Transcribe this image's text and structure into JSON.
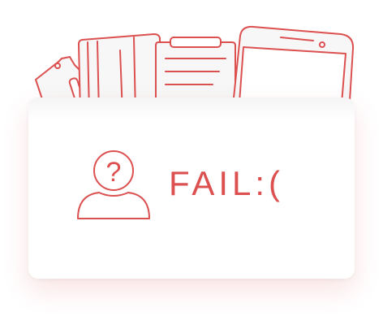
{
  "message": {
    "text": "FAIL:("
  },
  "icons": {
    "user": "unknown-user-icon",
    "question_mark": "?",
    "documents": [
      "ticket-icon",
      "card-icon",
      "clipboard-icon",
      "phone-icon"
    ]
  },
  "colors": {
    "accent": "#dc5050",
    "document_fill": "#f7f7f7",
    "card_background": "#ffffff"
  }
}
